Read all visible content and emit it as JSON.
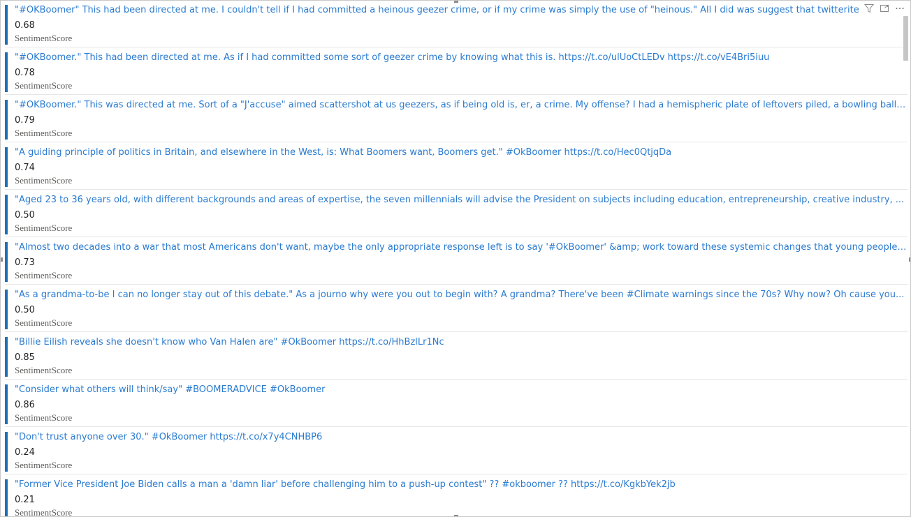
{
  "cards": [
    {
      "text": "\"#OKBoomer\" This had been directed at me. I couldn't tell if I had committed a heinous geezer crime, or if my crime was simply the use of \"heinous.\" All I did was suggest that twitterite I",
      "value": "0.68",
      "label": "SentimentScore"
    },
    {
      "text": "\"#OKBoomer.\" This had been directed at me. As if I had committed some sort of geezer crime by knowing what this is. https://t.co/ulUoCtLEDv https://t.co/vE4Bri5iuu",
      "value": "0.78",
      "label": "SentimentScore"
    },
    {
      "text": "\"#OKBoomer.\" This was directed at me. Sort of a \"J'accuse\" aimed scattershot at us geezers, as if being old is, er, a crime. My offense? I had a hemispheric plate of leftovers piled, a bowling ball c...",
      "value": "0.79",
      "label": "SentimentScore"
    },
    {
      "text": "\"A guiding principle of politics in Britain, and elsewhere in the West, is: What Boomers want, Boomers get.\" #OkBoomer https://t.co/Hec0QtjqDa",
      "value": "0.74",
      "label": "SentimentScore"
    },
    {
      "text": "\"Aged 23 to 36 years old, with different backgrounds and areas of expertise, the seven millennials will advise the President on subjects including education, entrepreneurship, creative industry, ...",
      "value": "0.50",
      "label": "SentimentScore"
    },
    {
      "text": "\"Almost two decades into a war that most Americans don't want, maybe the only appropriate response left is to say '#OkBoomer' &amp; work toward these systemic changes that young people ...",
      "value": "0.73",
      "label": "SentimentScore"
    },
    {
      "text": "\"As a grandma-to-be I can no longer stay out of this debate.\" As a journo why were you out to begin with? A grandma? There've been #Climate warnings since the 70s? Why now? Oh cause you...",
      "value": "0.50",
      "label": "SentimentScore"
    },
    {
      "text": "\"Billie Eilish reveals she doesn't know who Van Halen are\" #OkBoomer https://t.co/HhBzlLr1Nc",
      "value": "0.85",
      "label": "SentimentScore"
    },
    {
      "text": "\"Consider what others will think/say\" #BOOMERADVICE #OkBoomer",
      "value": "0.86",
      "label": "SentimentScore"
    },
    {
      "text": "\"Don't trust anyone over 30.\" #OkBoomer https://t.co/x7y4CNHBP6",
      "value": "0.24",
      "label": "SentimentScore"
    },
    {
      "text": "\"Former Vice President Joe Biden calls a man a 'damn liar' before challenging him to a push-up contest\" ?? #okboomer ?? https://t.co/KgkbYek2jb",
      "value": "0.21",
      "label": "SentimentScore"
    }
  ],
  "header_icons": [
    "filter-icon",
    "focus-mode-icon",
    "more-options-icon"
  ],
  "colors": {
    "accent_bar": "#1f6fb8",
    "link_text": "#2a7bd0",
    "value_text": "#252423",
    "label_text": "#605e5c"
  }
}
